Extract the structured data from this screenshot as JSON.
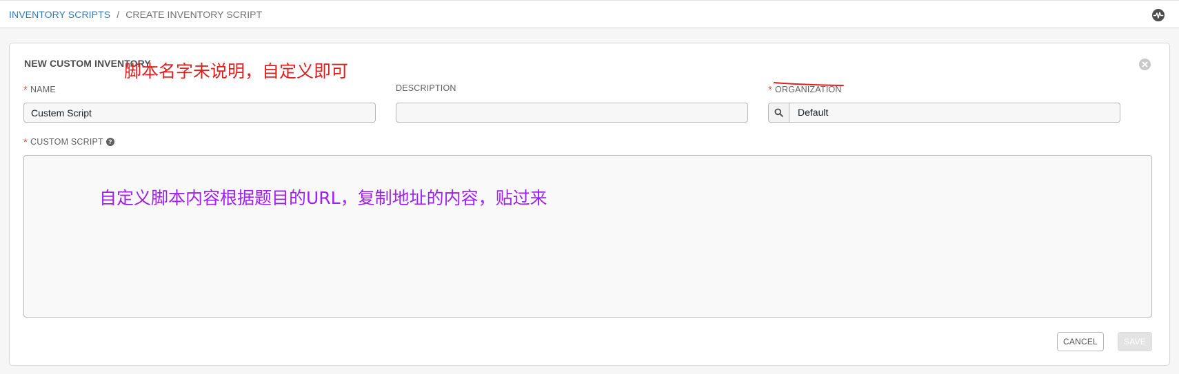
{
  "breadcrumb": {
    "parent": "INVENTORY SCRIPTS",
    "separator": "/",
    "current": "CREATE INVENTORY SCRIPT"
  },
  "panel": {
    "title": "NEW CUSTOM INVENTORY"
  },
  "form": {
    "name": {
      "required_mark": "*",
      "label": "NAME",
      "value": "Custem Script"
    },
    "description": {
      "label": "DESCRIPTION",
      "value": ""
    },
    "organization": {
      "required_mark": "*",
      "label": "ORGANIZATION",
      "value": "Default"
    },
    "custom_script": {
      "required_mark": "*",
      "label": "CUSTOM SCRIPT",
      "help_glyph": "?",
      "value": ""
    }
  },
  "buttons": {
    "cancel": "CANCEL",
    "save": "SAVE"
  },
  "annotations": {
    "name_note": "脚本名字未说明，自定义即可",
    "script_note": "自定义脚本内容根据题目的URL，复制地址的内容，贴过来",
    "name_note_color": "#e02020",
    "script_note_color": "#a020f0"
  },
  "colors": {
    "link": "#337ab7",
    "required": "#d9534f"
  },
  "icons": {
    "top_right": "activity-stream-icon",
    "panel_close": "close-circle-icon",
    "org_lookup": "search-icon",
    "script_help": "question-circle-icon"
  }
}
